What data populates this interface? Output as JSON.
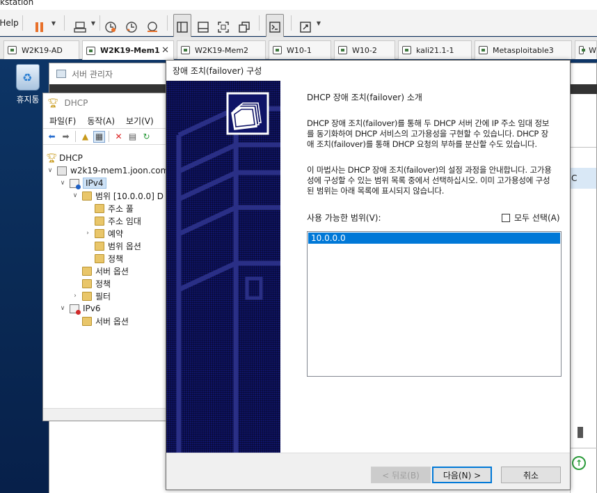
{
  "host": {
    "title_fragment": "kstation",
    "menu_help": "Help",
    "toolbar_icons": [
      "pause-icon",
      "send-keys-icon",
      "snapshot-icon",
      "revert-snapshot-icon",
      "snapshot-manager-icon",
      "console-view-icon",
      "unity-view-icon",
      "fullscreen-icon",
      "autofit-icon",
      "terminal-icon",
      "stretch-icon"
    ],
    "tabs": [
      {
        "label": "W2K19-AD",
        "active": false
      },
      {
        "label": "W2K19-Mem1",
        "active": true
      },
      {
        "label": "W2K19-Mem2",
        "active": false
      },
      {
        "label": "W10-1",
        "active": false
      },
      {
        "label": "W10-2",
        "active": false
      },
      {
        "label": "kali21.1-1",
        "active": false
      },
      {
        "label": "Metasploitable3",
        "active": false
      },
      {
        "label": "W",
        "active": false
      }
    ]
  },
  "desktop": {
    "recycle_bin_label": "휴지통"
  },
  "server_manager": {
    "title": "서버 관리자",
    "right_cell_text": "C"
  },
  "dhcp_console": {
    "title": "DHCP",
    "menu": [
      "파일(F)",
      "동작(A)",
      "보기(V)"
    ],
    "tree": {
      "root": "DHCP",
      "server": "w2k19-mem1.joon.com",
      "ipv4": "IPv4",
      "scope": "범위 [10.0.0.0] D",
      "address_pool": "주소 풀",
      "address_leases": "주소 임대",
      "reservations": "예약",
      "scope_options": "범위 옵션",
      "scope_policies": "정책",
      "server_options": "서버 옵션",
      "policies": "정책",
      "filters": "필터",
      "ipv6": "IPv6",
      "ipv6_server_options": "서버 옵션"
    }
  },
  "wizard": {
    "title": "장애 조치(failover) 구성",
    "heading": "DHCP 장애 조치(failover) 소개",
    "para1": "DHCP 장애 조치(failover)를 통해 두 DHCP 서버 간에 IP 주소 임대 정보를 동기화하여 DHCP 서비스의 고가용성을 구현할 수 있습니다. DHCP 장애 조치(failover)를 통해 DHCP 요청의 부하를 분산할 수도 있습니다.",
    "para2": "이 마법사는 DHCP 장애 조치(failover)의 설정 과정을 안내합니다. 고가용성에 구성할 수 있는 범위 목록 중에서 선택하십시오. 이미 고가용성에 구성된 범위는 아래 목록에 표시되지 않습니다.",
    "available_scopes_label": "사용 가능한 범위(V):",
    "select_all_label": "모두 선택(A)",
    "select_all_checked": false,
    "scopes": [
      "10.0.0.0"
    ],
    "buttons": {
      "back": "< 뒤로(B)",
      "next": "다음(N) >",
      "cancel": "취소"
    }
  },
  "colors": {
    "banner_blue": "#0f1467",
    "selection_blue": "#0078d7"
  }
}
